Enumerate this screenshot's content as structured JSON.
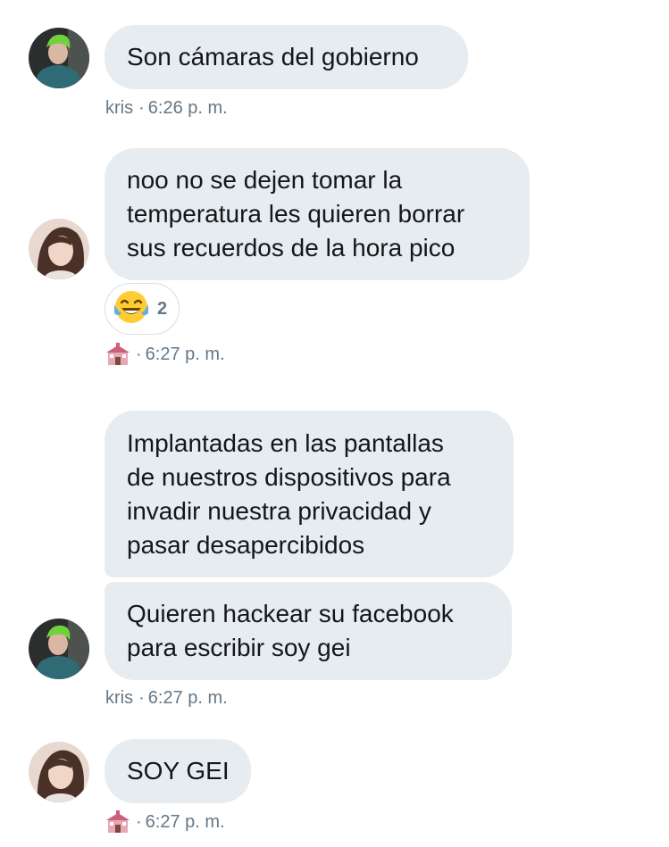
{
  "messages": [
    {
      "sender": "kris",
      "lines": [
        "Son cámaras del gobierno"
      ],
      "time": "6:26 p. m."
    },
    {
      "lines": [
        "noo no se dejen tomar la",
        "temperatura les quieren borrar",
        "sus recuerdos de la hora pico"
      ],
      "reaction": {
        "icon": "tears-of-joy-emoji",
        "count": "2"
      },
      "sender_icon": "school-building-icon",
      "time": "6:27 p. m."
    },
    {
      "lines": [
        "Implantadas en las pantallas",
        "de nuestros dispositivos para",
        "invadir nuestra privacidad y",
        "pasar desapercibidos"
      ]
    },
    {
      "sender": "kris",
      "lines": [
        "Quieren hackear su facebook",
        "para escribir soy gei"
      ],
      "time": "6:27 p. m."
    },
    {
      "lines": [
        "SOY GEI"
      ],
      "sender_icon": "school-building-icon",
      "time": "6:27 p. m."
    }
  ],
  "separator": "·",
  "colors": {
    "bubble": "#e6ecf0",
    "text": "#14171a",
    "meta": "#657786"
  }
}
